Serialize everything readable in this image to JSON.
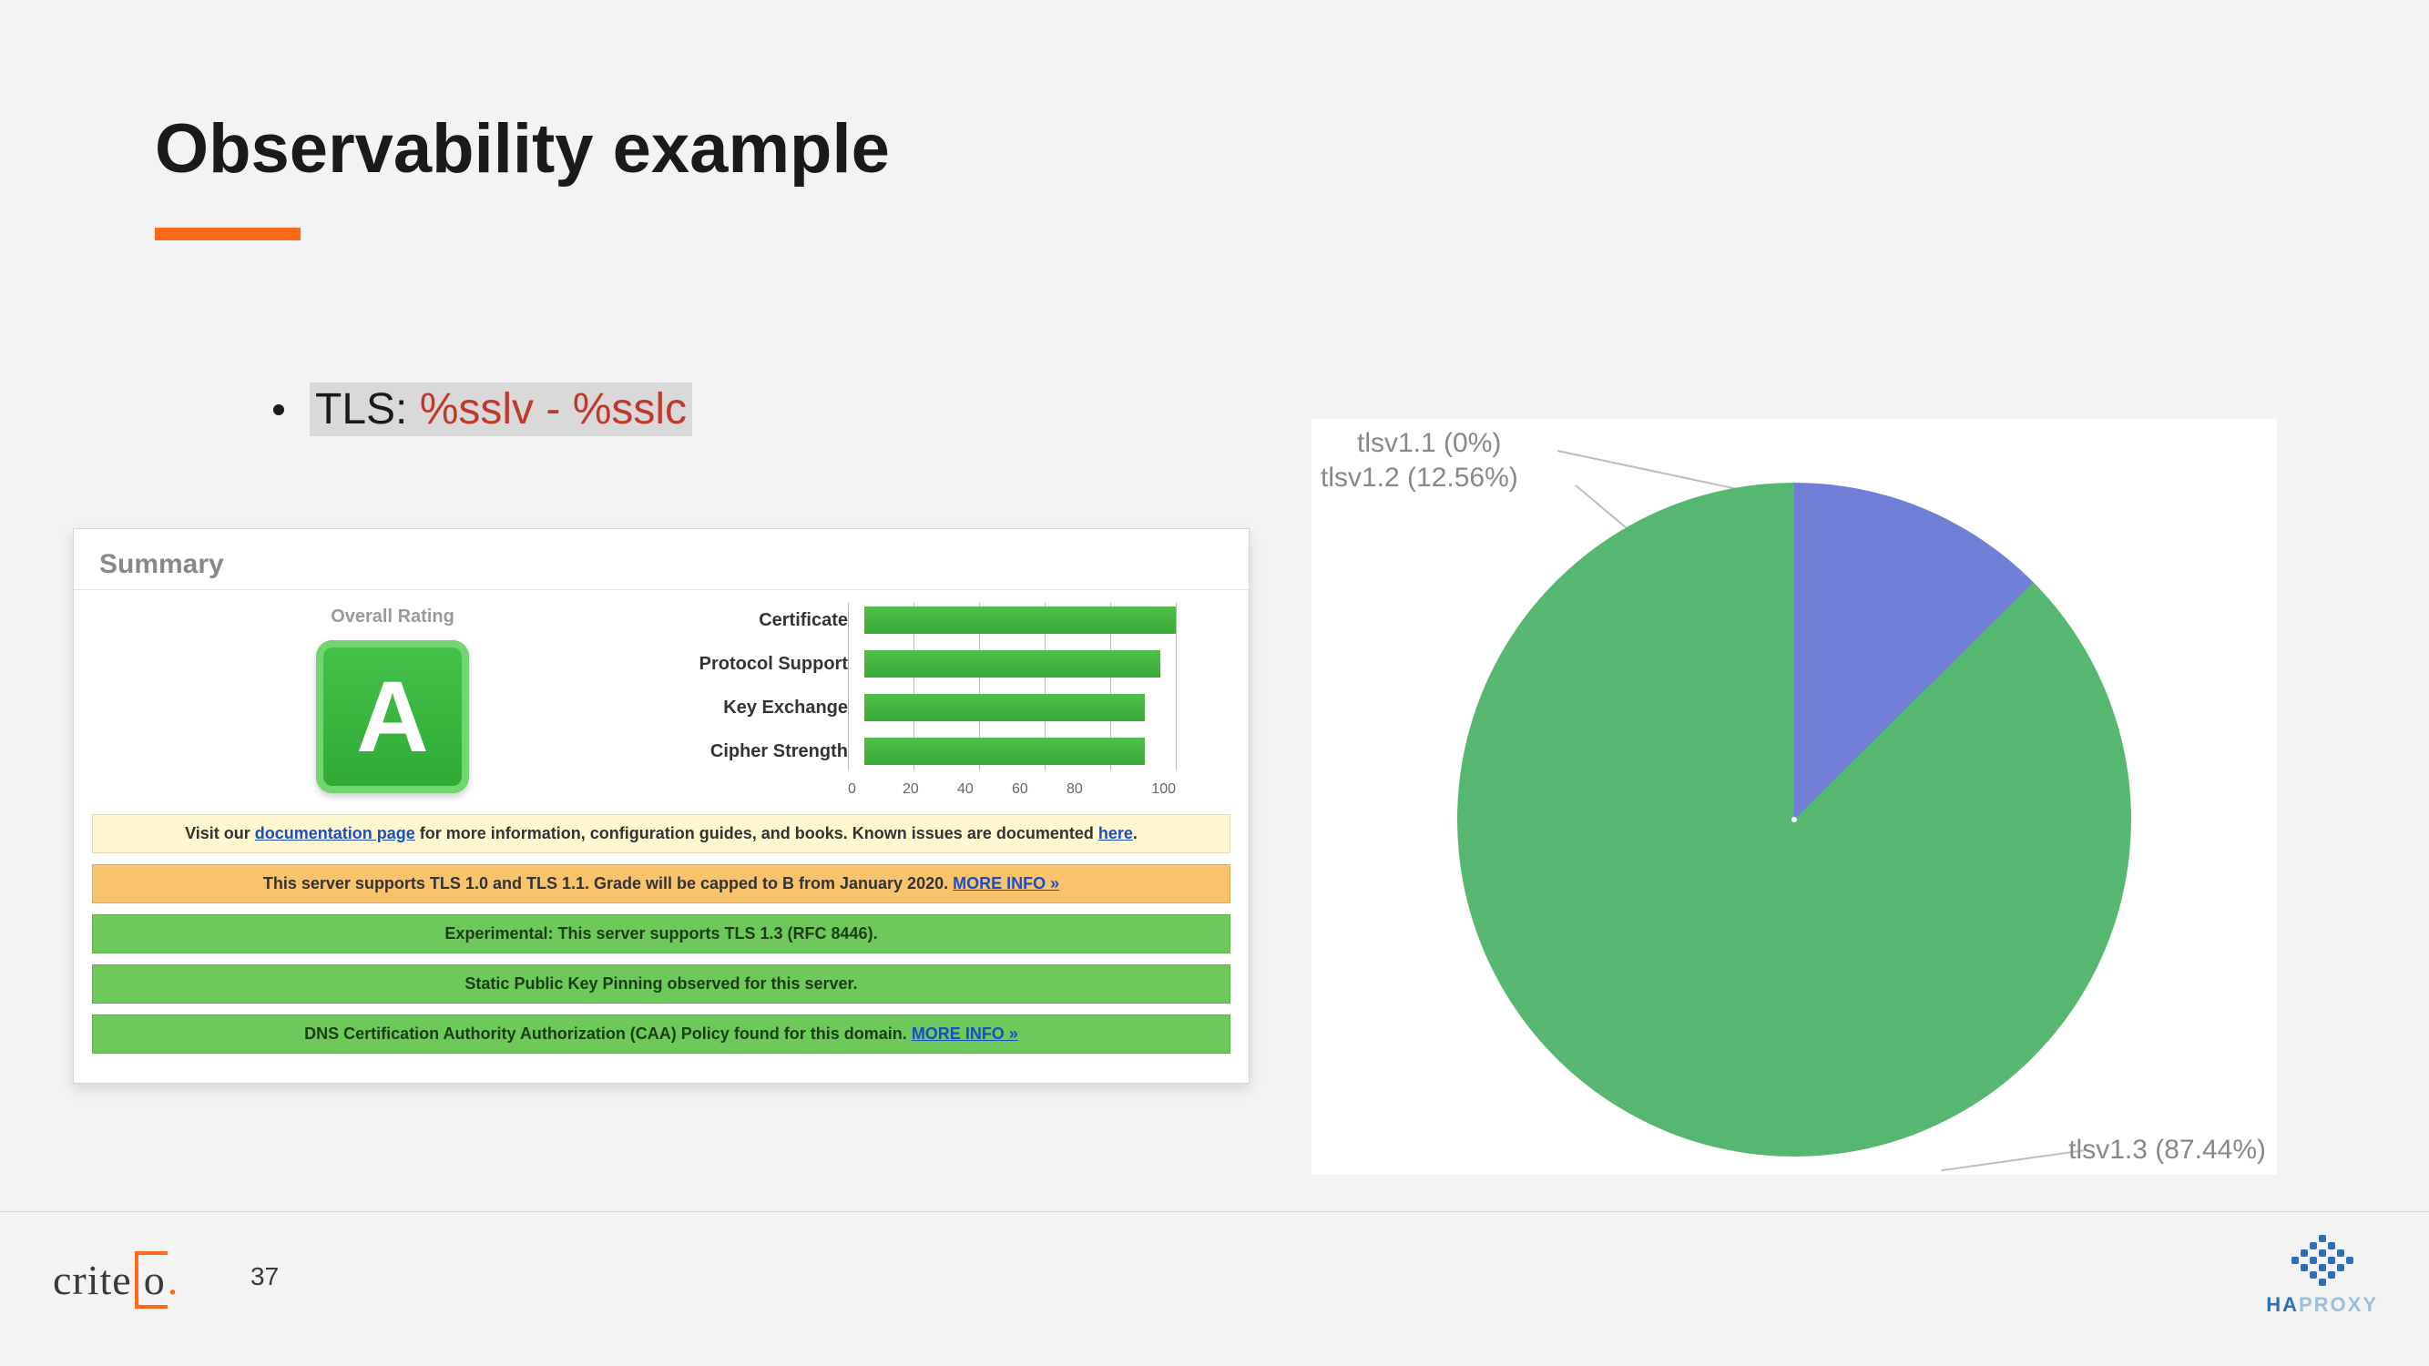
{
  "slide": {
    "title": "Observability example",
    "bullet_prefix": "TLS: ",
    "bullet_vars": "%sslv - %sslc",
    "page_number": "37"
  },
  "panel": {
    "header": "Summary",
    "rating_label": "Overall Rating",
    "rating_letter": "A",
    "bars": {
      "labels": [
        "Certificate",
        "Protocol Support",
        "Key Exchange",
        "Cipher Strength"
      ],
      "values": [
        100,
        95,
        90,
        90
      ],
      "ticks": [
        "0",
        "20",
        "40",
        "60",
        "80",
        "100"
      ]
    },
    "banners": {
      "b1_pre": "Visit our ",
      "b1_link": "documentation page",
      "b1_mid": " for more information, configuration guides, and books. Known issues are documented ",
      "b1_link2": "here",
      "b1_post": ".",
      "b2_text": "This server supports TLS 1.0 and TLS 1.1. Grade will be capped to B from January 2020. ",
      "b2_link": "MORE INFO »",
      "b3_text": "Experimental: This server supports TLS 1.3 (RFC 8446).",
      "b4_text": "Static Public Key Pinning observed for this server.",
      "b5_text": "DNS Certification Authority Authorization (CAA) Policy found for this domain.  ",
      "b5_link": "MORE INFO »"
    }
  },
  "chart_data": {
    "type": "pie",
    "title": "",
    "series": [
      {
        "name": "tlsv1.1",
        "value": 0.0,
        "label": "tlsv1.1 (0%)",
        "color": "#6f7fd6"
      },
      {
        "name": "tlsv1.2",
        "value": 12.56,
        "label": "tlsv1.2 (12.56%)",
        "color": "#6f7fd6"
      },
      {
        "name": "tlsv1.3",
        "value": 87.44,
        "label": "tlsv1.3 (87.44%)",
        "color": "#56b870"
      }
    ]
  },
  "logos": {
    "criteo": "criteo",
    "haproxy_ha": "HA",
    "haproxy_proxy": "PROXY"
  }
}
